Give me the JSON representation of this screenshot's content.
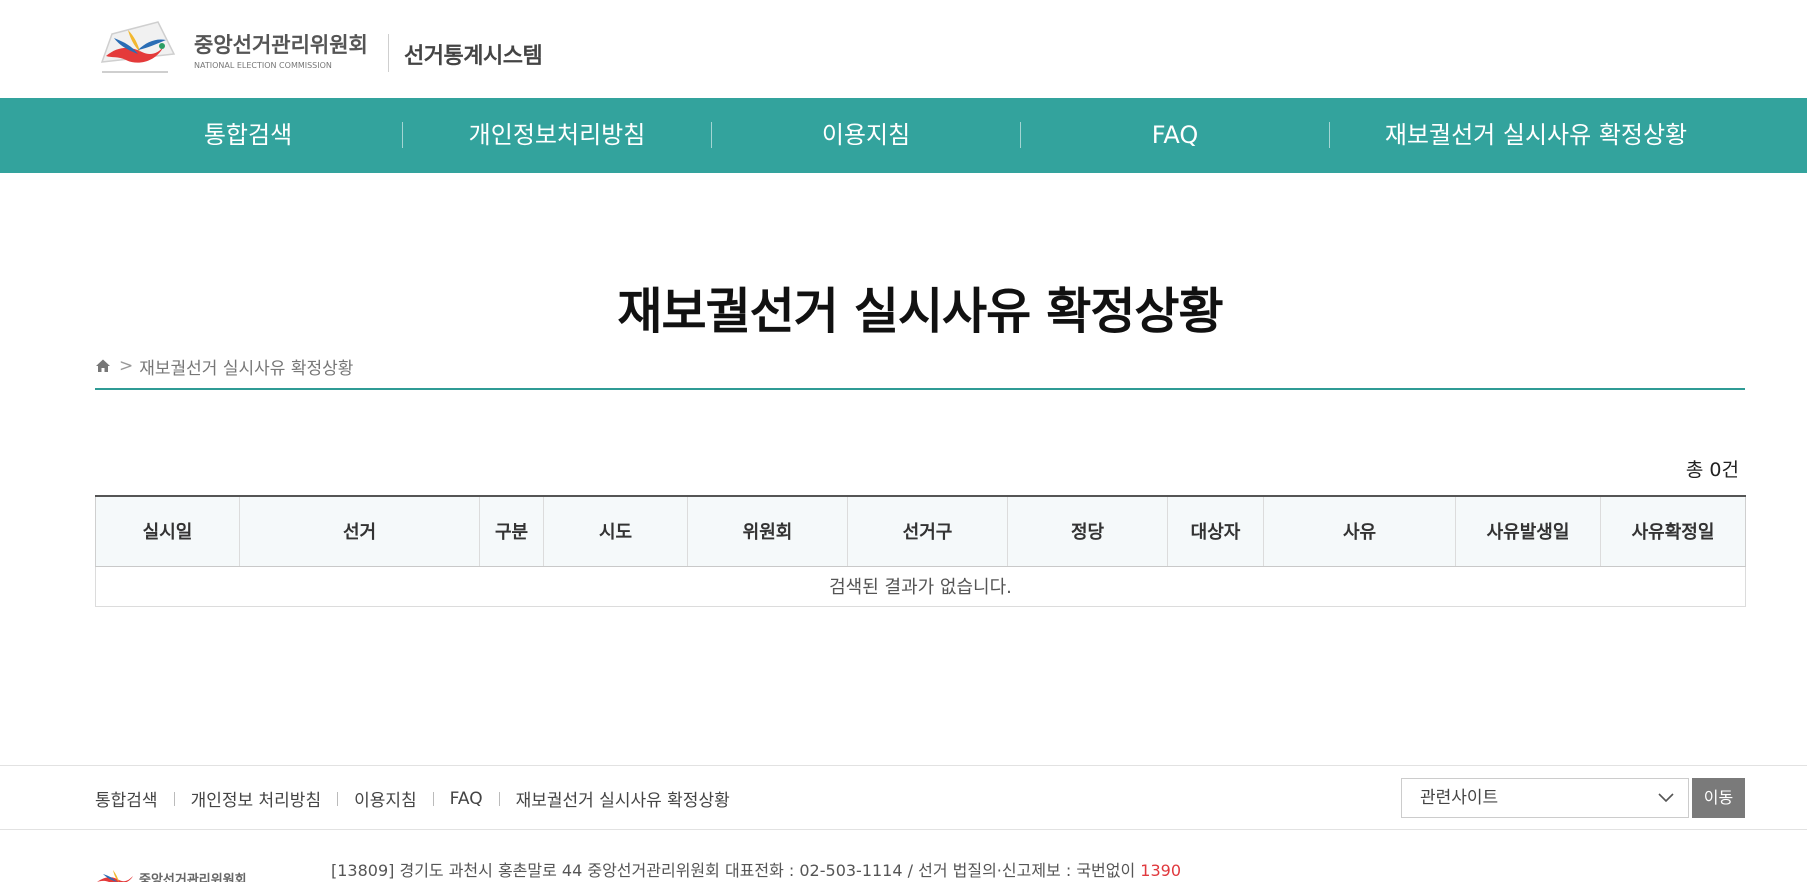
{
  "header": {
    "org_name_ko": "중앙선거관리위원회",
    "org_name_en": "NATIONAL ELECTION COMMISSION",
    "system_title": "선거통계시스템"
  },
  "nav": {
    "items": [
      {
        "label": "통합검색"
      },
      {
        "label": "개인정보처리방침"
      },
      {
        "label": "이용지침"
      },
      {
        "label": "FAQ"
      },
      {
        "label": "재보궐선거 실시사유 확정상황"
      }
    ],
    "background": "#33a39d"
  },
  "main": {
    "page_title": "재보궐선거 실시사유 확정상황",
    "breadcrumb": {
      "separator": ">",
      "current": "재보궐선거 실시사유 확정상황"
    },
    "total_label": "총 0건",
    "table": {
      "columns": [
        "실시일",
        "선거",
        "구분",
        "시도",
        "위원회",
        "선거구",
        "정당",
        "대상자",
        "사유",
        "사유발생일",
        "사유확정일"
      ],
      "empty_message": "검색된 결과가 없습니다."
    }
  },
  "footer": {
    "links": [
      "통합검색",
      "개인정보 처리방침",
      "이용지침",
      "FAQ",
      "재보궐선거 실시사유 확정상황"
    ],
    "related_select": {
      "selected": "관련사이트"
    },
    "go_label": "이동",
    "address_text": "[13809] 경기도 과천시 홍촌말로 44 중앙선거관리위원회 대표전화 : 02-503-1114 / 선거 법질의·신고제보 : 국번없이",
    "report_tel": "1390",
    "org_name_ko": "중앙선거관리위원회"
  },
  "icons": [
    "home-icon",
    "chevron-down-icon"
  ],
  "colors": {
    "accent": "#33a39d",
    "tel": "#e0393e"
  }
}
